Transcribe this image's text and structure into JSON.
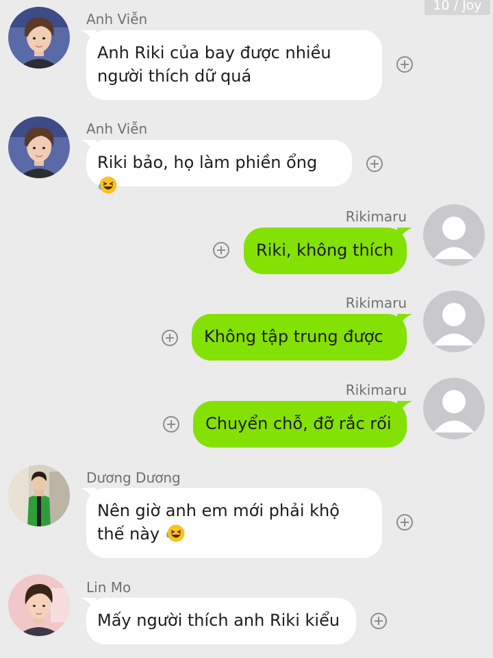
{
  "watermark": "10 / Joy",
  "colors": {
    "background": "#ebebeb",
    "incoming_bubble": "#ffffff",
    "outgoing_bubble": "#84e104",
    "name_text": "#707070",
    "message_text": "#1c1c1c",
    "placeholder_avatar": "#c9c9cd"
  },
  "messages": [
    {
      "sender": "Anh Viễn",
      "text": "Anh Riki của bay được nhiều\nngười thích dữ quá",
      "direction": "incoming",
      "avatar": "profile-photo",
      "emoji": ""
    },
    {
      "sender": "Anh Viễn",
      "text": "Riki bảo, họ làm phiền ổng",
      "direction": "incoming",
      "avatar": "profile-photo",
      "emoji": "rolling-laughing-emoji"
    },
    {
      "sender": "Rikimaru",
      "text": "Riki, không thích",
      "direction": "outgoing",
      "avatar": "default-avatar",
      "emoji": ""
    },
    {
      "sender": "Rikimaru",
      "text": "Không tập trung được",
      "direction": "outgoing",
      "avatar": "default-avatar",
      "emoji": ""
    },
    {
      "sender": "Rikimaru",
      "text": "Chuyển chỗ, đỡ rắc rối",
      "direction": "outgoing",
      "avatar": "default-avatar",
      "emoji": ""
    },
    {
      "sender": "Dương Dương",
      "text": "Nên giờ anh em mới phải khộ\nthế này",
      "direction": "incoming",
      "avatar": "profile-photo",
      "emoji": "rolling-laughing-emoji"
    },
    {
      "sender": "Lin Mo",
      "text": "Mấy người thích anh Riki kiểu",
      "direction": "incoming",
      "avatar": "profile-photo",
      "emoji": ""
    }
  ]
}
